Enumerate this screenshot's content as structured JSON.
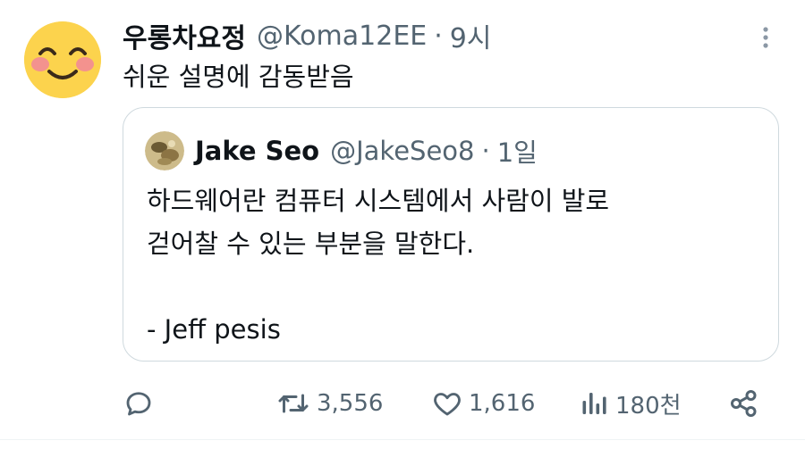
{
  "tweet": {
    "display_name": "우롱차요정",
    "handle": "@Koma12EE",
    "separator": "·",
    "time": "9시",
    "text": "쉬운 설명에 감동받음",
    "avatar_icon": "smiling-face-icon"
  },
  "quoted": {
    "display_name": "Jake Seo",
    "handle": "@JakeSeo8",
    "separator": "·",
    "time": "1일",
    "lines": [
      "하드웨어란 컴퓨터 시스템에서 사람이 발로",
      "걷어찰 수 있는 부분을 말한다.",
      "",
      "- Jeff pesis"
    ]
  },
  "actions": {
    "reply": {
      "icon": "reply-icon",
      "count": ""
    },
    "retweet": {
      "icon": "retweet-icon",
      "count": "3,556"
    },
    "like": {
      "icon": "heart-icon",
      "count": "1,616"
    },
    "views": {
      "icon": "views-icon",
      "count": "180천"
    },
    "share": {
      "icon": "share-icon",
      "count": ""
    }
  },
  "colors": {
    "text": "#0f1419",
    "secondary": "#536471",
    "border": "#cfd9de",
    "avatar_bg": "#fcd34d"
  }
}
